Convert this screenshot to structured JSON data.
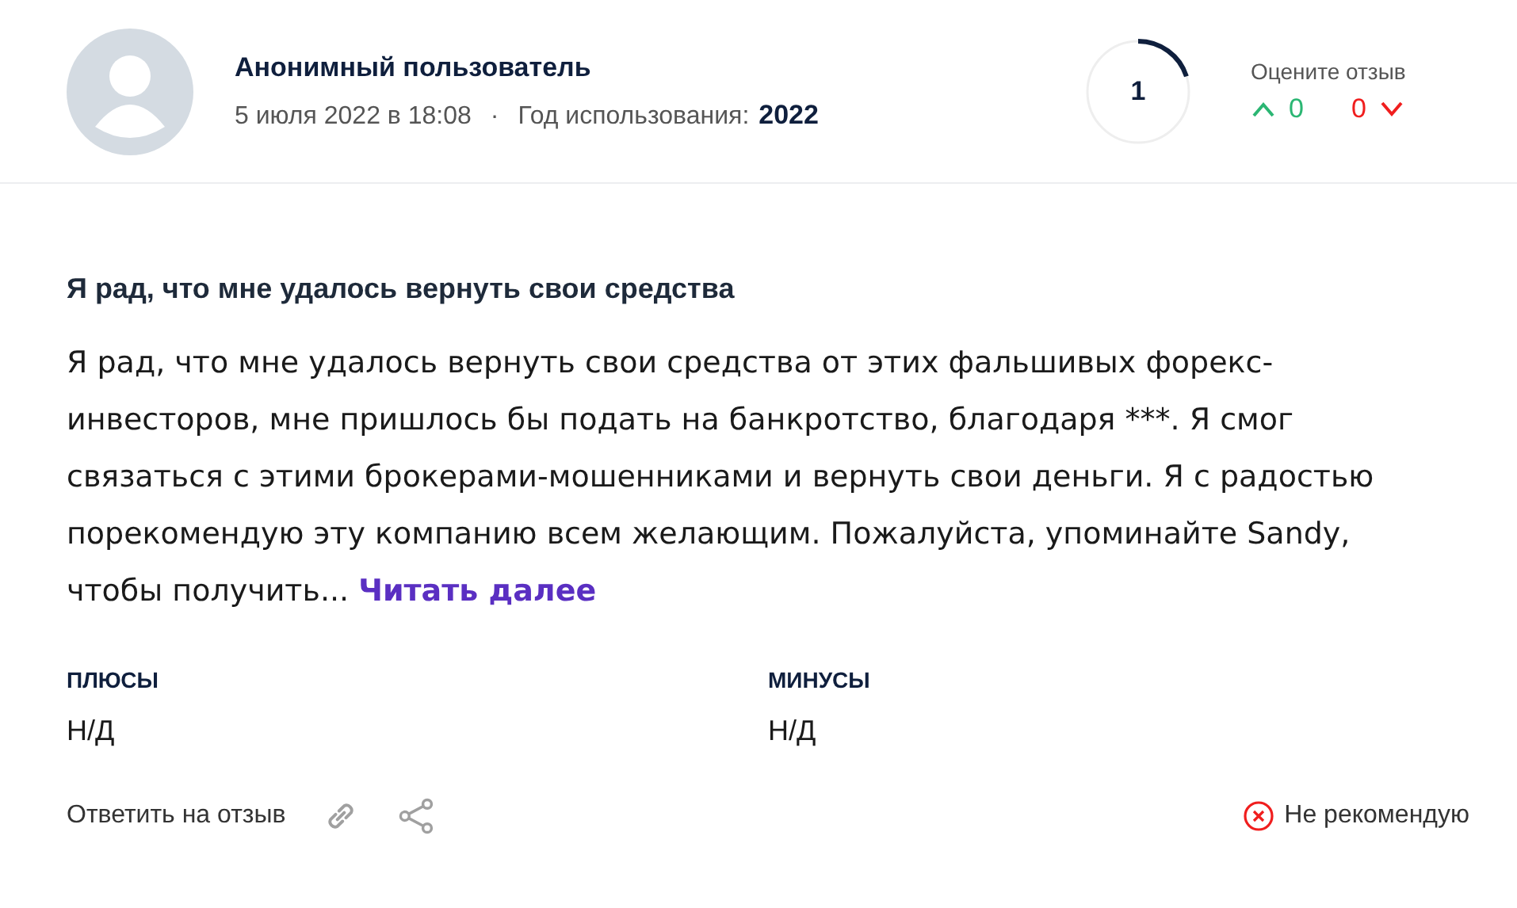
{
  "author": {
    "name": "Анонимный пользователь",
    "date": "5 июля 2022 в 18:08",
    "separator": "·",
    "usage_label": "Год использования:",
    "usage_year": "2022"
  },
  "rating": {
    "value": "1",
    "level": 0.2
  },
  "votes": {
    "label": "Оцените отзыв",
    "up": "0",
    "down": "0"
  },
  "review": {
    "title": "Я рад, что мне удалось вернуть свои средства",
    "text": "Я рад, что мне удалось вернуть свои средства от этих фальшивых форекс-инвесторов, мне пришлось бы подать на банкротство, благодаря ***. Я смог связаться с этими брокерами-мошенниками и вернуть свои деньги. Я с радостью порекомендую эту компанию всем желающим. Пожалуйста, упоминайте Sandy, чтобы получить...",
    "read_more": "Читать далее"
  },
  "pros": {
    "label": "ПЛЮСЫ",
    "value": "Н/Д"
  },
  "cons": {
    "label": "МИНУСЫ",
    "value": "Н/Д"
  },
  "footer": {
    "reply": "Ответить на отзыв",
    "recommend": false,
    "recommend_label": "Не рекомендую"
  }
}
